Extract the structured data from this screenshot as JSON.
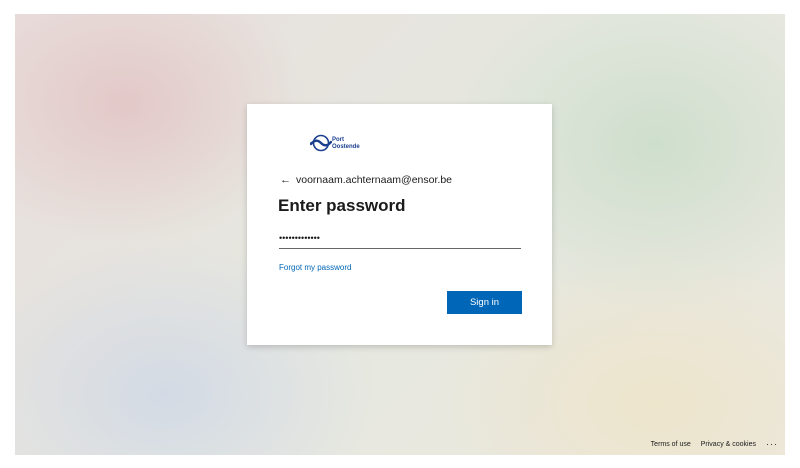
{
  "brand": {
    "logo_text": "Port\nOostende",
    "logo_color": "#1b3f8f"
  },
  "login": {
    "back_icon": "back-arrow-icon",
    "identity": "voornaam.achternaam@ensor.be",
    "heading": "Enter password",
    "password_value": "•••••••••••••",
    "forgot_link": "Forgot my password",
    "signin_label": "Sign in",
    "accent_color": "#0067b8"
  },
  "footer": {
    "terms": "Terms of use",
    "privacy": "Privacy & cookies",
    "more": "···"
  }
}
